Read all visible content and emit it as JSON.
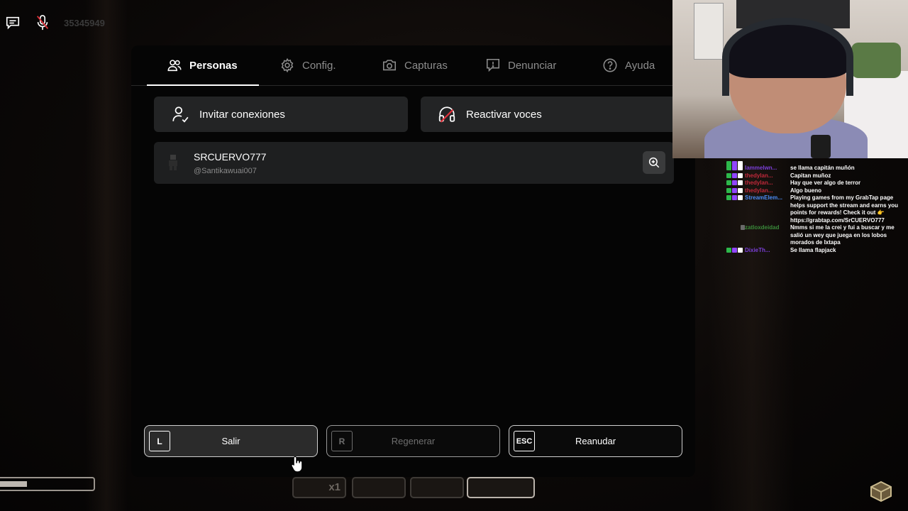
{
  "hud": {
    "player_id": "35345949",
    "chat_icon": "chat-icon",
    "mic_icon": "mic-muted-icon"
  },
  "menu": {
    "tabs": [
      {
        "label": "Personas",
        "icon": "people-icon",
        "active": true
      },
      {
        "label": "Config.",
        "icon": "gear-icon",
        "active": false
      },
      {
        "label": "Capturas",
        "icon": "camera-icon",
        "active": false
      },
      {
        "label": "Denunciar",
        "icon": "report-icon",
        "active": false
      },
      {
        "label": "Ayuda",
        "icon": "help-icon",
        "active": false
      }
    ],
    "invite_label": "Invitar conexiones",
    "voices_label": "Reactivar voces",
    "person": {
      "name": "SRCUERVO777",
      "handle": "@Santikawuai007"
    },
    "bottom": {
      "leave": {
        "key": "L",
        "label": "Salir"
      },
      "reset": {
        "key": "R",
        "label": "Regenerar"
      },
      "resume": {
        "key": "ESC",
        "label": "Reanudar"
      }
    }
  },
  "chat": [
    {
      "user": "",
      "message": "",
      "user_color": "#9146ff"
    },
    {
      "user": "lammelwn...",
      "message": "se llama capitán muñón",
      "user_color": "#7b3fd8"
    },
    {
      "user": "thedylan...",
      "message": "Capitan muñoz",
      "user_color": "#c0283a"
    },
    {
      "user": "thedylan...",
      "message": "Hay que ver algo de terror",
      "user_color": "#c0283a"
    },
    {
      "user": "thedylan...",
      "message": "Algo bueno",
      "user_color": "#c0283a"
    },
    {
      "user": "StreamElem...",
      "message": "Playing games from my GrabTap page helps support the stream and earns you points for rewards! Check it out 👉 https://grabtap.com/SrCUERVO777",
      "user_color": "#4b8cf5"
    },
    {
      "user": "zatloxdeidad",
      "message": "Nmms si me la crei y fui a buscar y me salió un wey que juega en los lobos morados de Ixtapa",
      "user_color": "#3a8a3a"
    },
    {
      "user": "DixieTh...",
      "message": "Se llama flapjack",
      "user_color": "#7b3fd8"
    }
  ],
  "hotbar": {
    "slot1_count": "x1"
  },
  "colors": {
    "panel_bg": "#050505",
    "button_bg": "#232425",
    "active_tab": "#ffffff",
    "inactive_tab": "#8d8d8d"
  }
}
